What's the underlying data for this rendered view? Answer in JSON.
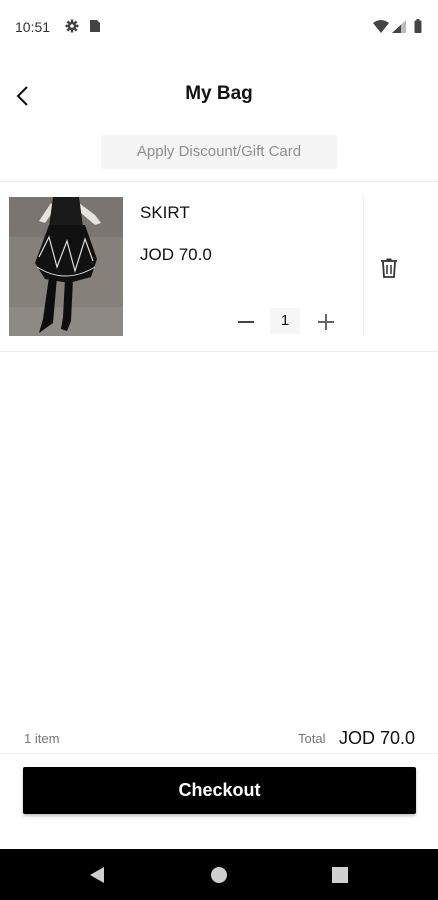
{
  "status_bar": {
    "time": "10:51",
    "icons": [
      "gear-icon",
      "sim-card-icon",
      "wifi-icon",
      "signal-icon",
      "battery-icon"
    ]
  },
  "header": {
    "back_icon": "chevron-left-icon",
    "title": "My Bag"
  },
  "discount": {
    "label": "Apply Discount/Gift Card"
  },
  "cart": {
    "items": [
      {
        "name": "SKIRT",
        "price": "JOD 70.0",
        "quantity": "1",
        "image": "product-photo-black-skirt"
      }
    ]
  },
  "summary": {
    "item_count": "1 item",
    "total_label": "Total",
    "total_value": "JOD 70.0"
  },
  "checkout": {
    "label": "Checkout"
  },
  "nav_bar": {
    "icons": [
      "nav-back-icon",
      "nav-home-icon",
      "nav-recents-icon"
    ]
  },
  "colors": {
    "primary": "#000000",
    "background": "#ffffff",
    "muted_text": "#8f8f8f"
  }
}
